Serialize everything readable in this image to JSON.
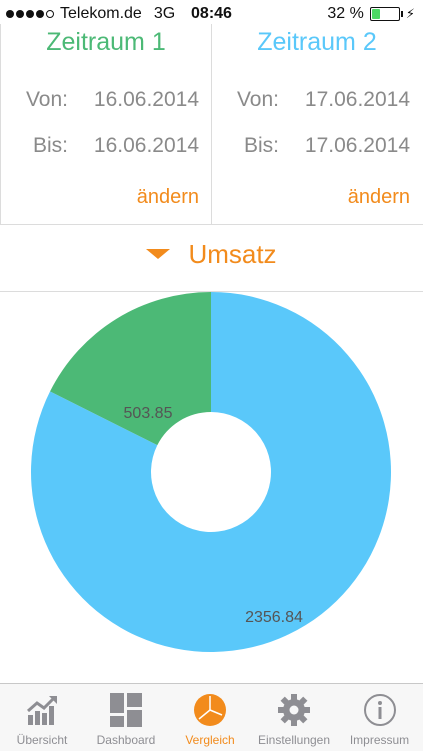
{
  "status_bar": {
    "carrier": "Telekom.de",
    "network": "3G",
    "time": "08:46",
    "battery_text": "32 %",
    "battery_level": 0.32,
    "signal_bars_filled": 4,
    "signal_bars_total": 5
  },
  "periods": [
    {
      "title": "Zeitraum 1",
      "color": "#4cb976",
      "from_label": "Von:",
      "from_value": "16.06.2014",
      "to_label": "Bis:",
      "to_value": "16.06.2014",
      "change_label": "ändern"
    },
    {
      "title": "Zeitraum 2",
      "color": "#5ac8fa",
      "from_label": "Von:",
      "from_value": "17.06.2014",
      "to_label": "Bis:",
      "to_value": "17.06.2014",
      "change_label": "ändern"
    }
  ],
  "metric": {
    "label": "Umsatz",
    "color": "#f28b1c"
  },
  "chart_data": {
    "type": "pie",
    "values": [
      503.85,
      2356.84
    ],
    "labels": [
      "503.85",
      "2356.84"
    ],
    "colors": [
      "#4cb976",
      "#5ac8fa"
    ],
    "donut": true
  },
  "tabs": [
    {
      "label": "Übersicht",
      "icon": "chart-trend-icon",
      "active": false
    },
    {
      "label": "Dashboard",
      "icon": "grid-icon",
      "active": false
    },
    {
      "label": "Vergleich",
      "icon": "pie-icon",
      "active": true
    },
    {
      "label": "Einstellungen",
      "icon": "gear-icon",
      "active": false
    },
    {
      "label": "Impressum",
      "icon": "info-icon",
      "active": false
    }
  ],
  "accent_color": "#f28b1c"
}
